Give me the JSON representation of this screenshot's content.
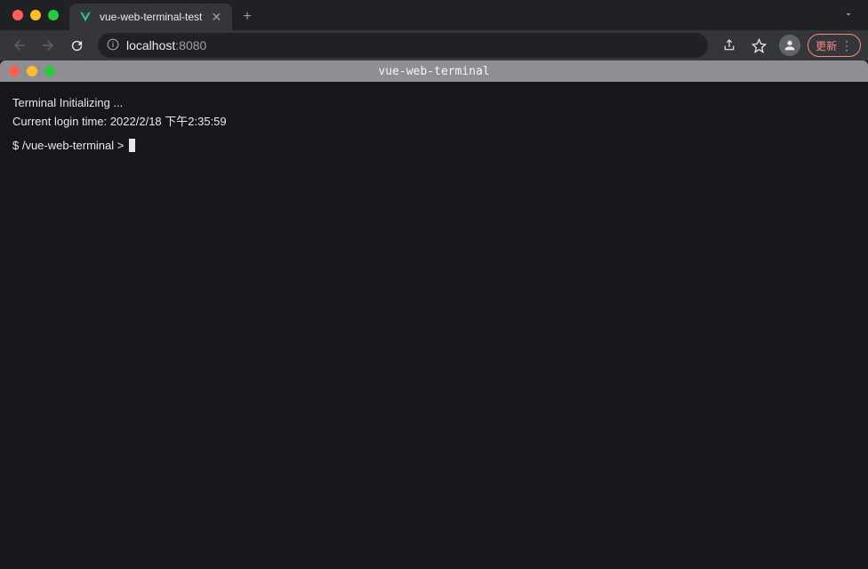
{
  "browser": {
    "tab": {
      "title": "vue-web-terminal-test",
      "favicon_color": "#42b883"
    },
    "address": {
      "host": "localhost",
      "port": ":8080"
    },
    "update_button_label": "更新"
  },
  "app": {
    "title": "vue-web-terminal"
  },
  "terminal": {
    "lines": [
      "Terminal Initializing ...",
      "Current login time: 2022/2/18 下午2:35:59"
    ],
    "prompt": "$ /vue-web-terminal > "
  }
}
